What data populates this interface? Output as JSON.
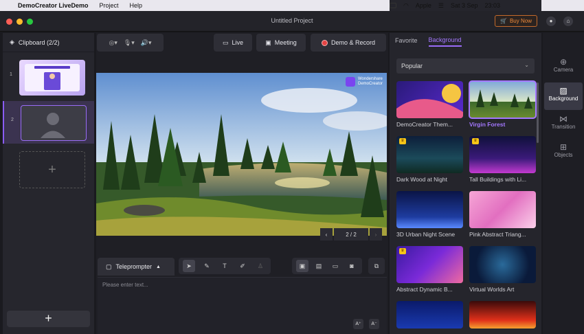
{
  "menubar": {
    "app_name": "DemoCreator LiveDemo",
    "menus": [
      "Project",
      "Help"
    ],
    "apple_label": "Apple",
    "datetime": "Sat 3 Sep",
    "time": "23:03"
  },
  "window": {
    "title": "Untitled Project",
    "buy_now": "Buy Now"
  },
  "clipboard": {
    "title": "Clipboard (2/2)",
    "items": [
      {
        "num": "1"
      },
      {
        "num": "2"
      }
    ],
    "add_symbol": "+"
  },
  "toolbar": {
    "live": "Live",
    "meeting": "Meeting",
    "demo_record": "Demo & Record"
  },
  "stage": {
    "watermark_line1": "Wondershare",
    "watermark_line2": "DemoCreator"
  },
  "pager": {
    "prev": "‹",
    "text": "2 / 2",
    "next": "›"
  },
  "teleprompter": {
    "label": "Teleprompter",
    "placeholder": "Please enter text...",
    "font_up": "A⁺",
    "font_down": "A⁻"
  },
  "right_panel": {
    "tabs": [
      "Favorite",
      "Background"
    ],
    "active_tab": "Background",
    "category": "Popular",
    "backgrounds": [
      {
        "label": "DemoCreator Them...",
        "premium": false,
        "selected": false
      },
      {
        "label": "Virgin Forest",
        "premium": false,
        "selected": true
      },
      {
        "label": "Dark Wood at Night",
        "premium": true,
        "selected": false
      },
      {
        "label": "Tall Buildings with Li...",
        "premium": true,
        "selected": false
      },
      {
        "label": "3D Urban Night Scene",
        "premium": false,
        "selected": false
      },
      {
        "label": "Pink Abstract Triang...",
        "premium": false,
        "selected": false
      },
      {
        "label": "Abstract Dynamic B...",
        "premium": true,
        "selected": false
      },
      {
        "label": "Virtual Worlds Art",
        "premium": false,
        "selected": false
      }
    ]
  },
  "rail": {
    "items": [
      {
        "label": "Camera",
        "icon": "camera-icon"
      },
      {
        "label": "Background",
        "icon": "background-icon"
      },
      {
        "label": "Transition",
        "icon": "transition-icon"
      },
      {
        "label": "Objects",
        "icon": "objects-icon"
      }
    ],
    "active": "Background"
  },
  "colors": {
    "accent": "#9a6cf8",
    "record": "#e44343",
    "buy_now": "#f08a3a"
  }
}
